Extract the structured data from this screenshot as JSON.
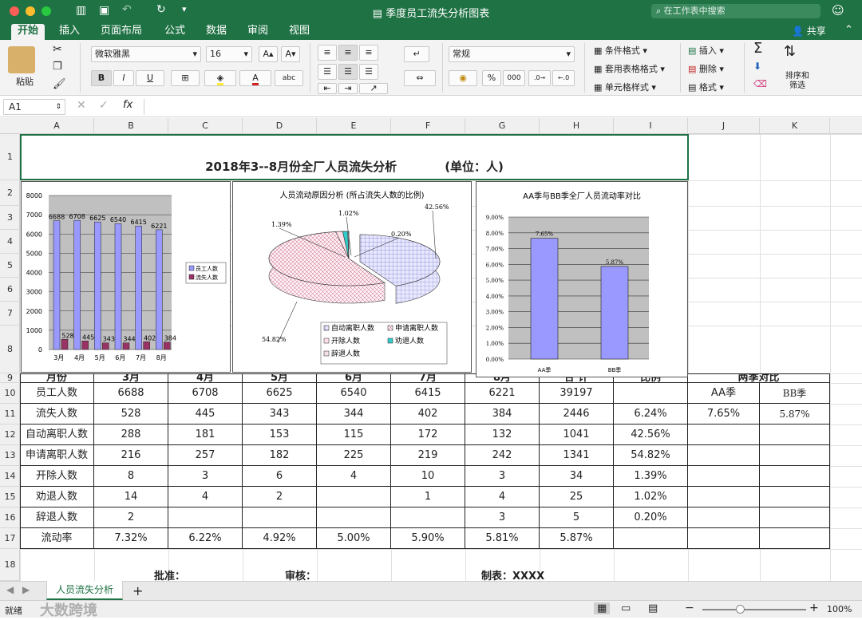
{
  "app": {
    "title": "季度员工流失分析图表",
    "search_placeholder": "在工作表中搜索"
  },
  "tabs": [
    {
      "label": "开始"
    },
    {
      "label": "插入"
    },
    {
      "label": "页面布局"
    },
    {
      "label": "公式"
    },
    {
      "label": "数据"
    },
    {
      "label": "审阅"
    },
    {
      "label": "视图"
    }
  ],
  "share_label": "共享",
  "ribbon": {
    "paste_label": "粘贴",
    "font_name": "微软雅黑",
    "font_size": "16",
    "bold": "B",
    "italic": "I",
    "underline": "U",
    "number_format": "常规",
    "percent": "%",
    "thousands": "000",
    "cond_format": "条件格式",
    "table_format": "套用表格格式",
    "cell_style": "单元格样式",
    "insert": "插入",
    "delete": "删除",
    "format": "格式",
    "sort_filter_1": "排序和",
    "sort_filter_2": "筛选",
    "sum": "Σ"
  },
  "formula_bar": {
    "cell_ref": "A1",
    "fx": "fx",
    "content": ""
  },
  "columns": [
    "A",
    "B",
    "C",
    "D",
    "E",
    "F",
    "G",
    "H",
    "I",
    "J",
    "K"
  ],
  "rows": [
    "1",
    "2",
    "3",
    "4",
    "5",
    "6",
    "7",
    "8",
    "9",
    "10",
    "11",
    "12",
    "13",
    "14",
    "15",
    "16",
    "17",
    "18"
  ],
  "sheet": {
    "title": "2018年3--8月份全厂人员流失分析",
    "unit": "(单位：人)",
    "header": [
      "月份",
      "3月",
      "4月",
      "5月",
      "6月",
      "7月",
      "8月",
      "合  计",
      "比例"
    ],
    "compare_header": "两季对比",
    "compare_labels": [
      "AA季",
      "BB季"
    ],
    "compare_values": [
      "7.65%",
      "5.87%"
    ],
    "rows": [
      [
        "员工人数",
        "6688",
        "6708",
        "6625",
        "6540",
        "6415",
        "6221",
        "39197",
        ""
      ],
      [
        "流失人数",
        "528",
        "445",
        "343",
        "344",
        "402",
        "384",
        "2446",
        "6.24%"
      ],
      [
        "自动离职人数",
        "288",
        "181",
        "153",
        "115",
        "172",
        "132",
        "1041",
        "42.56%"
      ],
      [
        "申请离职人数",
        "216",
        "257",
        "182",
        "225",
        "219",
        "242",
        "1341",
        "54.82%"
      ],
      [
        "开除人数",
        "8",
        "3",
        "6",
        "4",
        "10",
        "3",
        "34",
        "1.39%"
      ],
      [
        "劝退人数",
        "14",
        "4",
        "2",
        "",
        "1",
        "4",
        "25",
        "1.02%"
      ],
      [
        "辞退人数",
        "2",
        "",
        "",
        "",
        "",
        "3",
        "5",
        "0.20%"
      ],
      [
        "流动率",
        "7.32%",
        "6.22%",
        "4.92%",
        "5.00%",
        "5.90%",
        "5.81%",
        "5.87%",
        ""
      ]
    ],
    "footer": [
      "批准：",
      "审核：",
      "制表：XXXX"
    ]
  },
  "sheet_tab": "人员流失分析",
  "status": {
    "ready": "就绪",
    "zoom": "100%",
    "minus": "−",
    "plus": "+"
  },
  "watermark": "大数跨境",
  "chart_data": [
    {
      "type": "bar",
      "categories": [
        "3月",
        "4月",
        "5月",
        "6月",
        "7月",
        "8月"
      ],
      "series": [
        {
          "name": "员工人数",
          "values": [
            6688,
            6708,
            6625,
            6540,
            6415,
            6221
          ]
        },
        {
          "name": "流失人数",
          "values": [
            528,
            445,
            343,
            344,
            402,
            384
          ]
        }
      ],
      "ylim": [
        0,
        8000
      ],
      "yticks": [
        "8000",
        "7000",
        "6000",
        "5000",
        "4000",
        "3000",
        "2000",
        "1000",
        "0"
      ],
      "colors": [
        "#9999ff",
        "#993366"
      ],
      "legend": "right",
      "grid": true
    },
    {
      "type": "pie",
      "title": "人员流动原因分析 (所占流失人数的比例)",
      "categories": [
        "自动离职人数",
        "申请离职人数",
        "开除人数",
        "劝退人数",
        "辞退人数"
      ],
      "values": [
        42.56,
        54.82,
        1.39,
        1.02,
        0.2
      ],
      "labels": [
        "42.56%",
        "54.82%",
        "1.39%",
        "1.02%",
        "0.20%"
      ],
      "colors": [
        "#c8c8f0",
        "#f0c8d8",
        "#ffe0e8",
        "#33cccc",
        "#f8e0e8"
      ],
      "legend": "bottom"
    },
    {
      "type": "bar",
      "title": "AA季与BB季全厂人员流动率对比",
      "categories": [
        "AA季",
        "BB季"
      ],
      "values": [
        7.65,
        5.87
      ],
      "labels": [
        "7.65%",
        "5.87%"
      ],
      "ylim": [
        0,
        9
      ],
      "yticks": [
        "9.00%",
        "8.00%",
        "7.00%",
        "6.00%",
        "5.00%",
        "4.00%",
        "3.00%",
        "2.00%",
        "1.00%",
        "0.00%"
      ],
      "colors": [
        "#9999ff"
      ],
      "grid": true
    }
  ]
}
